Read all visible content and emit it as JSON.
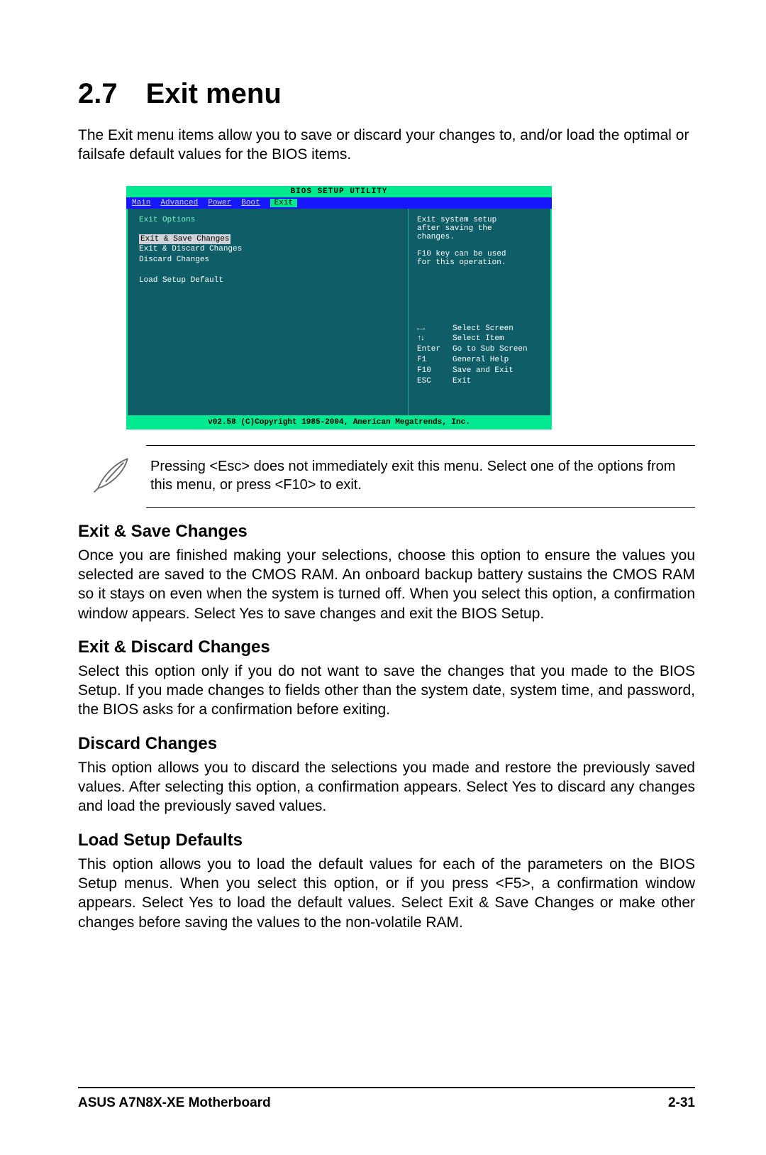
{
  "heading": {
    "number": "2.7",
    "title": "Exit menu"
  },
  "intro": "The Exit menu items allow you to save or discard your changes to, and/or load the optimal or failsafe default values for the BIOS items.",
  "bios": {
    "title": "BIOS SETUP UTILITY",
    "tabs": [
      "Main",
      "Advanced",
      "Power",
      "Boot",
      "Exit"
    ],
    "active_tab": "Exit",
    "section_label": "Exit Options",
    "options": [
      "Exit & Save Changes",
      "Exit & Discard Changes",
      "Discard Changes"
    ],
    "option_gap": "Load Setup Default",
    "help_text": [
      "Exit system setup",
      "after saving the",
      "changes.",
      "",
      "F10 key can be used",
      "for this operation."
    ],
    "keys": [
      {
        "k": "arrow-lr",
        "label": "Select Screen"
      },
      {
        "k": "arrow-ud",
        "label": "Select Item"
      },
      {
        "k": "Enter",
        "label": "Go to Sub Screen"
      },
      {
        "k": "F1",
        "label": "General Help"
      },
      {
        "k": "F10",
        "label": "Save and Exit"
      },
      {
        "k": "ESC",
        "label": "Exit"
      }
    ],
    "footer": "v02.58 (C)Copyright 1985-2004, American Megatrends, Inc."
  },
  "note": "Pressing <Esc> does not immediately exit this menu. Select one of the options from this menu, or press <F10> to exit.",
  "sections": [
    {
      "title": "Exit & Save Changes",
      "body": "Once you are finished making your selections, choose this option to ensure the values you selected are saved to the CMOS RAM. An onboard backup battery sustains the CMOS RAM so it stays on even when the system is turned off. When you select this option, a confirmation window appears. Select Yes to save changes and exit the BIOS Setup."
    },
    {
      "title": "Exit & Discard Changes",
      "body": "Select this option only if you do not want to save the changes that you  made to the BIOS Setup. If you made changes to fields other than the system date, system time, and password, the BIOS asks for a confirmation before exiting."
    },
    {
      "title": "Discard Changes",
      "body": "This option allows you to discard the selections you made and restore the previously saved values. After selecting this option, a confirmation appears. Select Yes to discard any changes and load the previously saved values."
    },
    {
      "title": "Load Setup Defaults",
      "body": "This option allows you to load the default values for each of the parameters on the BIOS Setup menus. When you select this option, or if you press <F5>, a confirmation window appears. Select Yes to load the default values. Select Exit & Save Changes or make other changes before saving the values to the non-volatile RAM."
    }
  ],
  "footer": {
    "left": "ASUS A7N8X-XE Motherboard",
    "right": "2-31"
  }
}
